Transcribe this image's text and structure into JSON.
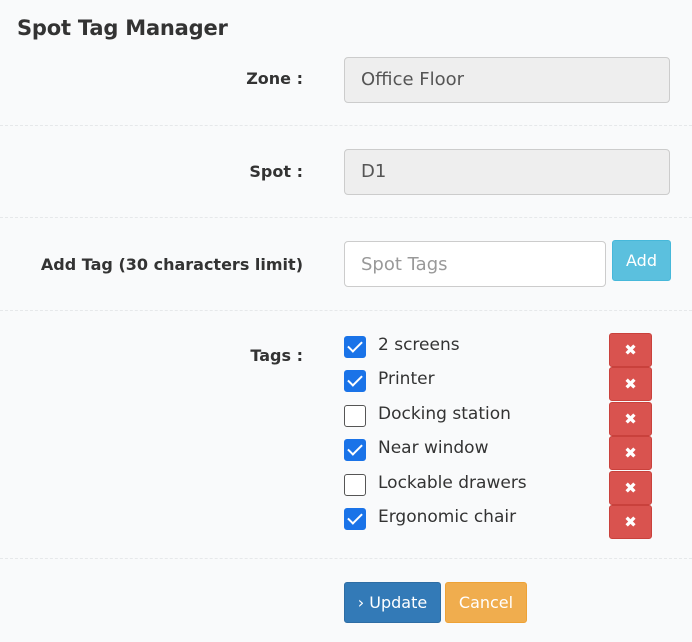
{
  "page": {
    "title": "Spot Tag Manager"
  },
  "form": {
    "zone_label": "Zone :",
    "zone_value": "Office Floor",
    "spot_label": "Spot :",
    "spot_value": "D1",
    "add_tag_label": "Add Tag (30 characters limit)",
    "add_tag_placeholder": "Spot Tags",
    "add_button": "Add",
    "tags_label": "Tags :"
  },
  "tags": [
    {
      "label": "2 screens",
      "checked": true
    },
    {
      "label": "Printer",
      "checked": true
    },
    {
      "label": "Docking station",
      "checked": false
    },
    {
      "label": "Near window",
      "checked": true
    },
    {
      "label": "Lockable drawers",
      "checked": false
    },
    {
      "label": "Ergonomic chair",
      "checked": true
    }
  ],
  "icons": {
    "delete": "close-x-icon",
    "update": "chevron-right-icon"
  },
  "actions": {
    "update": "Update",
    "cancel": "Cancel",
    "update_prefix": "›"
  },
  "colors": {
    "primary": "#337ab7",
    "info": "#5bc0de",
    "danger": "#d9534f",
    "warning": "#f0ad4e",
    "checkbox": "#1a73e8"
  }
}
